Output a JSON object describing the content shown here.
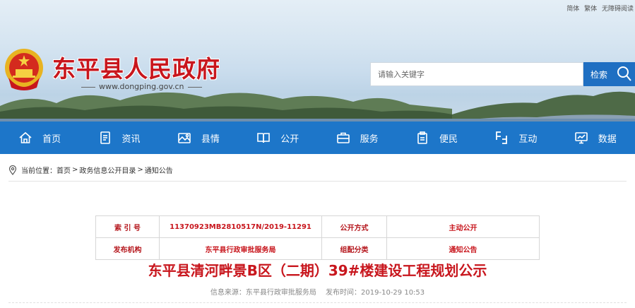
{
  "toplinks": {
    "simplified": "简体",
    "traditional": "繁体",
    "accessibility": "无障碍阅读"
  },
  "header": {
    "site_title": "东平县人民政府",
    "domain": "www.dongping.gov.cn",
    "search_placeholder": "请输入关键字",
    "search_button": "检索"
  },
  "nav": [
    {
      "label": "首页",
      "icon": "home-icon"
    },
    {
      "label": "资讯",
      "icon": "document-icon"
    },
    {
      "label": "县情",
      "icon": "picture-icon"
    },
    {
      "label": "公开",
      "icon": "book-icon"
    },
    {
      "label": "服务",
      "icon": "briefcase-icon"
    },
    {
      "label": "便民",
      "icon": "clipboard-icon"
    },
    {
      "label": "互动",
      "icon": "interaction-icon"
    },
    {
      "label": "数据",
      "icon": "monitor-icon"
    }
  ],
  "breadcrumb": {
    "prefix": "当前位置：",
    "items": [
      "首页",
      "政务信息公开目录",
      "通知公告"
    ],
    "separator": ">"
  },
  "info": {
    "index_label": "索 引 号",
    "index_value": "11370923MB2810517N/2019-11291",
    "method_label": "公开方式",
    "method_value": "主动公开",
    "publisher_label": "发布机构",
    "publisher_value": "东平县行政审批服务局",
    "category_label": "组配分类",
    "category_value": "通知公告"
  },
  "article": {
    "title": "东平县清河畔景B区（二期）39#楼建设工程规划公示",
    "source_label": "信息来源：",
    "source_value": "东平县行政审批服务局",
    "time_label": "发布时间：",
    "time_value": "2019-10-29 10:53"
  },
  "colors": {
    "brand_red": "#c8161d",
    "nav_blue": "#1d76c9",
    "search_blue": "#1f6fc2"
  }
}
